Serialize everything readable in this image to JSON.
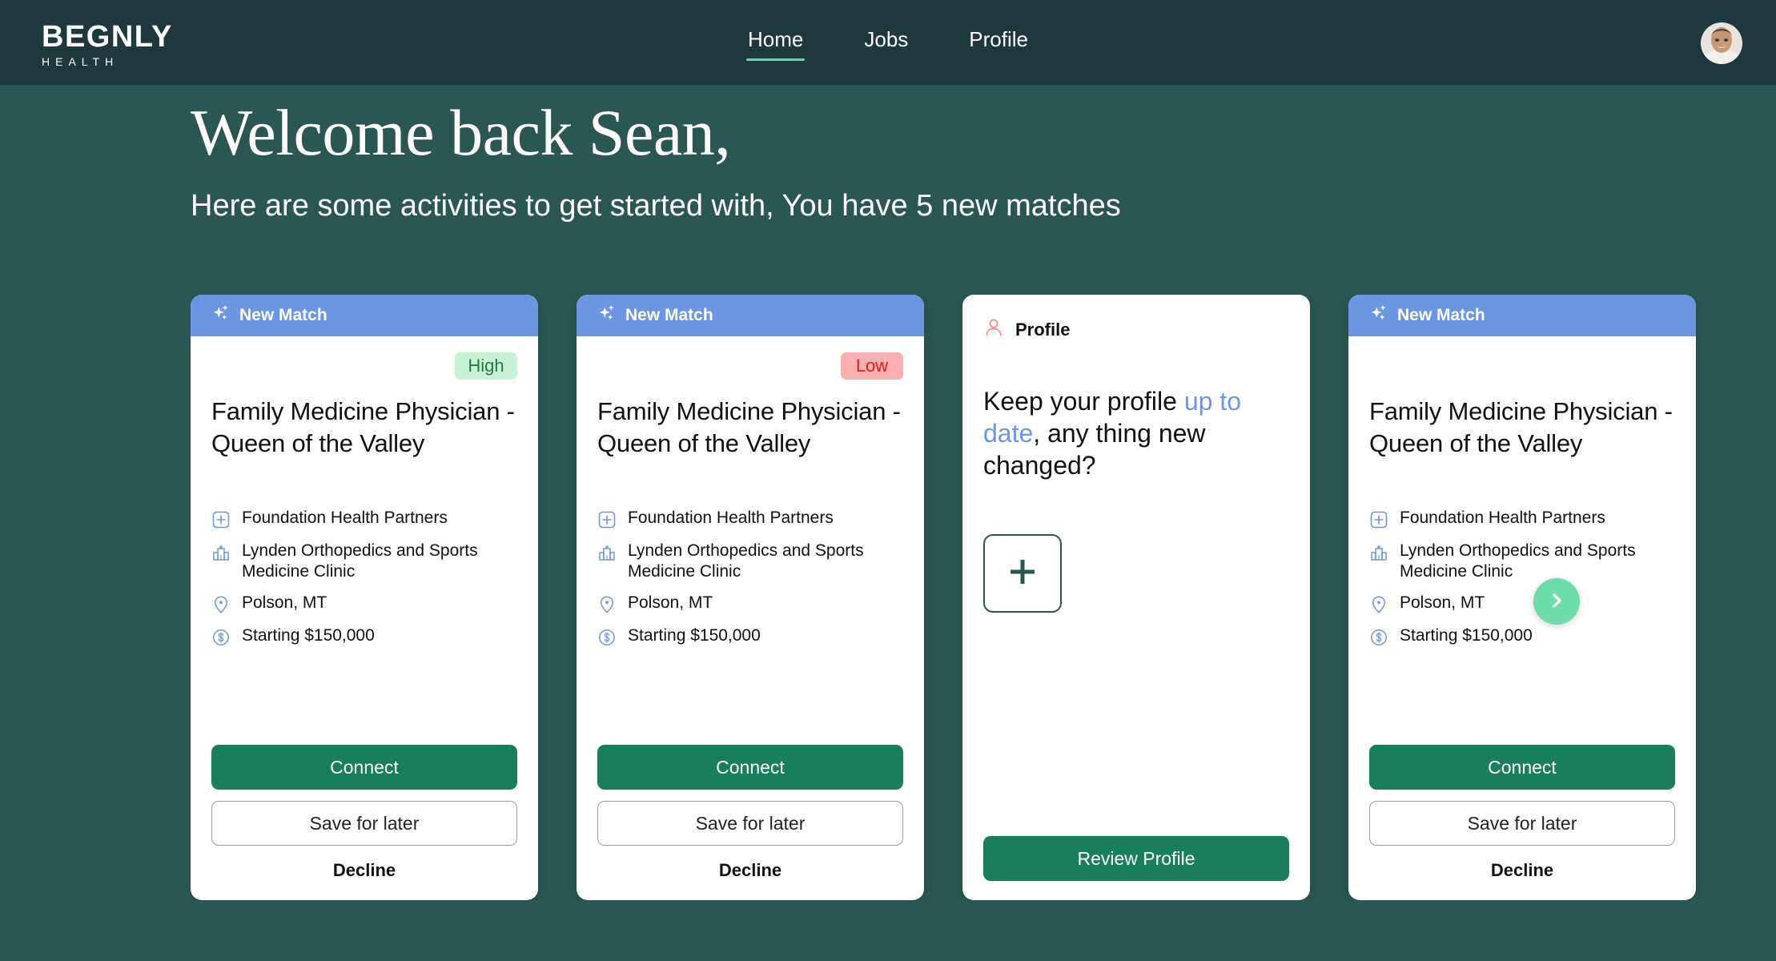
{
  "brand": {
    "name": "BEGNLY",
    "tagline": "HEALTH"
  },
  "nav": {
    "items": [
      {
        "label": "Home",
        "active": true
      },
      {
        "label": "Jobs",
        "active": false
      },
      {
        "label": "Profile",
        "active": false
      }
    ],
    "avatar_name": "user-avatar"
  },
  "hero": {
    "title": "Welcome back Sean,",
    "subtitle": "Here are some activities to get started with, You have 5 new matches"
  },
  "cards": [
    {
      "header_label": "New Match",
      "header_icon": "sparkle-icon",
      "badge": {
        "label": "High",
        "tone": "high"
      },
      "job_title": "Family Medicine Physician - Queen of the Valley",
      "details": [
        {
          "icon": "medical-cross-icon",
          "text": "Foundation Health Partners"
        },
        {
          "icon": "hospital-building-icon",
          "text": "Lynden Orthopedics and Sports Medicine Clinic"
        },
        {
          "icon": "location-pin-icon",
          "text": "Polson, MT"
        },
        {
          "icon": "dollar-circle-icon",
          "text": "Starting $150,000"
        }
      ],
      "primary_label": "Connect",
      "secondary_label": "Save for later",
      "tertiary_label": "Decline"
    },
    {
      "header_label": "New Match",
      "header_icon": "sparkle-icon",
      "badge": {
        "label": "Low",
        "tone": "low"
      },
      "job_title": "Family Medicine Physician - Queen of the Valley",
      "details": [
        {
          "icon": "medical-cross-icon",
          "text": "Foundation Health Partners"
        },
        {
          "icon": "hospital-building-icon",
          "text": "Lynden Orthopedics and Sports Medicine Clinic"
        },
        {
          "icon": "location-pin-icon",
          "text": "Polson, MT"
        },
        {
          "icon": "dollar-circle-icon",
          "text": "Starting $150,000"
        }
      ],
      "primary_label": "Connect",
      "secondary_label": "Save for later",
      "tertiary_label": "Decline"
    },
    {
      "header_label": "New Match",
      "header_icon": "sparkle-icon",
      "job_title": "Family Medicine Physician - Queen of the Valley",
      "details": [
        {
          "icon": "medical-cross-icon",
          "text": "Foundation Health Partners"
        },
        {
          "icon": "hospital-building-icon",
          "text": "Lynden Orthopedics and Sports Medicine Clinic"
        },
        {
          "icon": "location-pin-icon",
          "text": "Polson, MT"
        },
        {
          "icon": "dollar-circle-icon",
          "text": "Starting $150,000"
        }
      ],
      "primary_label": "Connect",
      "secondary_label": "Save for later",
      "tertiary_label": "Decline"
    }
  ],
  "profile_card": {
    "header_label": "Profile",
    "header_icon": "person-icon",
    "copy_part1": "Keep your profile ",
    "copy_highlight": "up to date",
    "copy_part2": ", any thing new changed?",
    "add_icon": "plus-icon",
    "primary_label": "Review Profile"
  },
  "carousel": {
    "next_icon": "chevron-right-icon"
  },
  "colors": {
    "page_background": "#2a5751",
    "topbar_background": "#1d393b",
    "card_header_blue": "#6d96e2",
    "primary_green": "#197f5b",
    "accent_mint": "#6fdcab",
    "badge_high_bg": "#c8f2d6",
    "badge_high_text": "#247a46",
    "badge_low_bg": "#f9b0ae",
    "badge_low_text": "#d6202a",
    "detail_icon_blue": "#6d96e2",
    "profile_icon_pink": "#f08a87",
    "nav_underline": "#5fd6a8"
  }
}
